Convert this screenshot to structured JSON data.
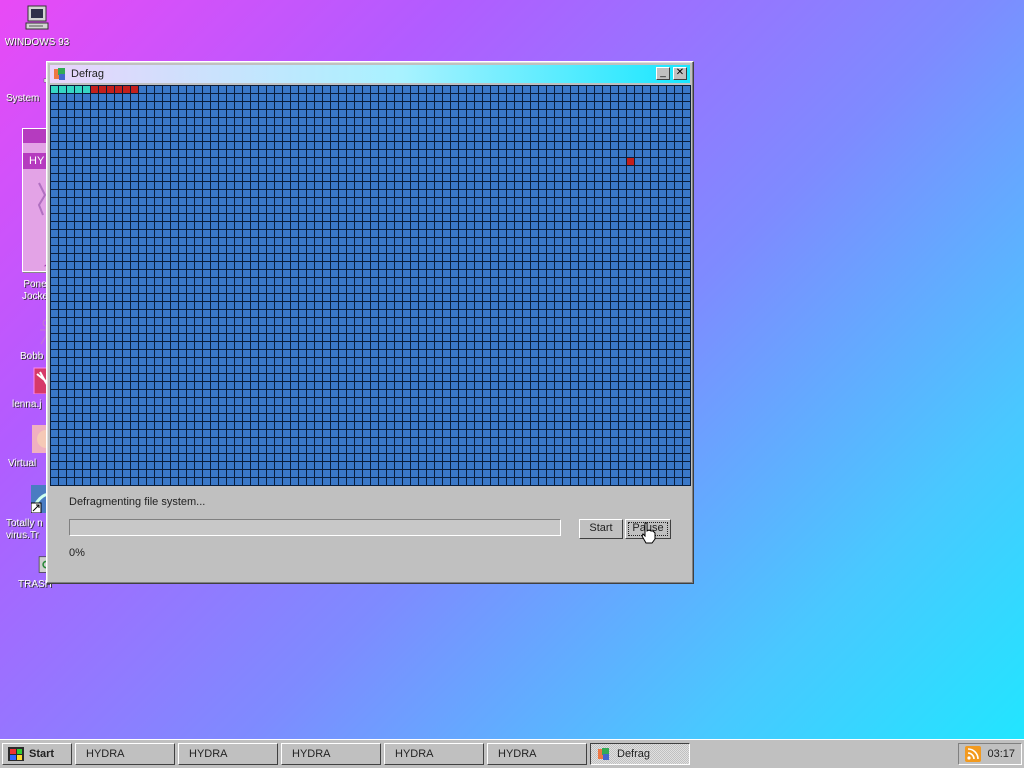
{
  "desktop": {
    "icons": [
      {
        "label": "WINDOWS 93",
        "icon": "computer-icon"
      },
      {
        "label": "System",
        "icon": "drive-icon"
      },
      {
        "label": "Pone Jocke",
        "icon": "character-icon"
      },
      {
        "label": "Bobb",
        "icon": "stick-figure-icon"
      },
      {
        "label": "lenna.j",
        "icon": "image-file-icon"
      },
      {
        "label": "Virtual",
        "icon": "face-icon"
      },
      {
        "label": "Totally n virus.Tr",
        "icon": "shortcut-icon"
      },
      {
        "label": "TRASH",
        "icon": "trash-icon"
      }
    ],
    "bg_window_label": "HY"
  },
  "window": {
    "title": "Defrag",
    "status": "Defragmenting file system...",
    "progress_percent": 0,
    "percent_label": "0%",
    "start_label": "Start",
    "pause_label": "Pause",
    "minimize_symbol": "_",
    "close_symbol": "✕",
    "colors": {
      "block": "#3a78c8",
      "done": "#36d6c4",
      "active": "#c3201c",
      "frame": "#0a1e3c"
    },
    "blocks": {
      "done_count": 5,
      "active_count": 6,
      "stray_active": [
        {
          "row": 9,
          "col": 72
        }
      ]
    }
  },
  "taskbar": {
    "start_label": "Start",
    "tasks": [
      {
        "label": "HYDRA",
        "active": false
      },
      {
        "label": "HYDRA",
        "active": false
      },
      {
        "label": "HYDRA",
        "active": false
      },
      {
        "label": "HYDRA",
        "active": false
      },
      {
        "label": "HYDRA",
        "active": false
      },
      {
        "label": "Defrag",
        "active": true
      }
    ],
    "clock": "03:17"
  }
}
